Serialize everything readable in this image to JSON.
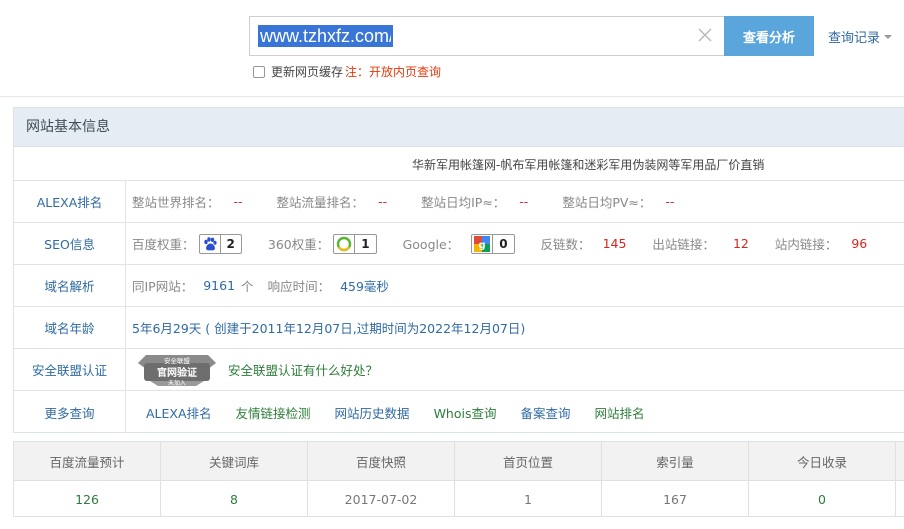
{
  "search": {
    "value": "www.tzhxfz.com/",
    "button_label": "查看分析",
    "history_label": "查询记录",
    "cache_label": "更新网页缓存",
    "cache_note": "注：开放内页查询"
  },
  "panel": {
    "title": "网站基本信息",
    "site_title": "华新军用帐篷网-帆布军用帐篷和迷彩军用伪装网等军用品厂价直销",
    "alexa": {
      "label": "ALEXA排名",
      "items": [
        {
          "key": "整站世界排名：",
          "value": "--"
        },
        {
          "key": "整站流量排名：",
          "value": "--"
        },
        {
          "key": "整站日均IP≈：",
          "value": "--"
        },
        {
          "key": "整站日均PV≈：",
          "value": "--"
        }
      ]
    },
    "seo": {
      "label": "SEO信息",
      "baidu_key": "百度权重：",
      "baidu_value": "2",
      "so360_key": "360权重：",
      "so360_value": "1",
      "google_key": "Google：",
      "google_value": "0",
      "backlinks_key": "反链数：",
      "backlinks_value": "145",
      "outlinks_key": "出站链接：",
      "outlinks_value": "12",
      "inlinks_key": "站内链接：",
      "inlinks_value": "96"
    },
    "dns": {
      "label": "域名解析",
      "ip_key": "同IP网站：",
      "ip_value": "9161",
      "ip_unit": "个",
      "resp_key": "响应时间：",
      "resp_value": "459毫秒"
    },
    "age": {
      "label": "域名年龄",
      "value": "5年6月29天 ( 创建于2011年12月07日,过期时间为2022年12月07日)"
    },
    "alliance": {
      "label": "安全联盟认证",
      "badge_top": "安全联盟",
      "badge_main": "官网验证",
      "badge_sub": "未加入",
      "link": "安全联盟认证有什么好处？"
    },
    "more": {
      "label": "更多查询",
      "links": [
        "ALEXA排名",
        "友情链接检测",
        "网站历史数据",
        "Whois查询",
        "备案查询",
        "网站排名"
      ]
    }
  },
  "stats": {
    "headers": [
      "百度流量预计",
      "关键词库",
      "百度快照",
      "首页位置",
      "索引量",
      "今日收录"
    ],
    "values": [
      "126",
      "8",
      "2017-07-02",
      "1",
      "167",
      "0"
    ]
  },
  "colors": {
    "accent_button": "#5aa5dc",
    "link_blue": "#2f6aa3",
    "value_red": "#d9261c",
    "value_green": "#2e7d3a",
    "panel_header": "#e6ecf3"
  },
  "icons": [
    "close-icon",
    "chevron-down-icon",
    "baidu-paw-icon",
    "so360-icon",
    "google-icon",
    "shield-badge-icon"
  ]
}
